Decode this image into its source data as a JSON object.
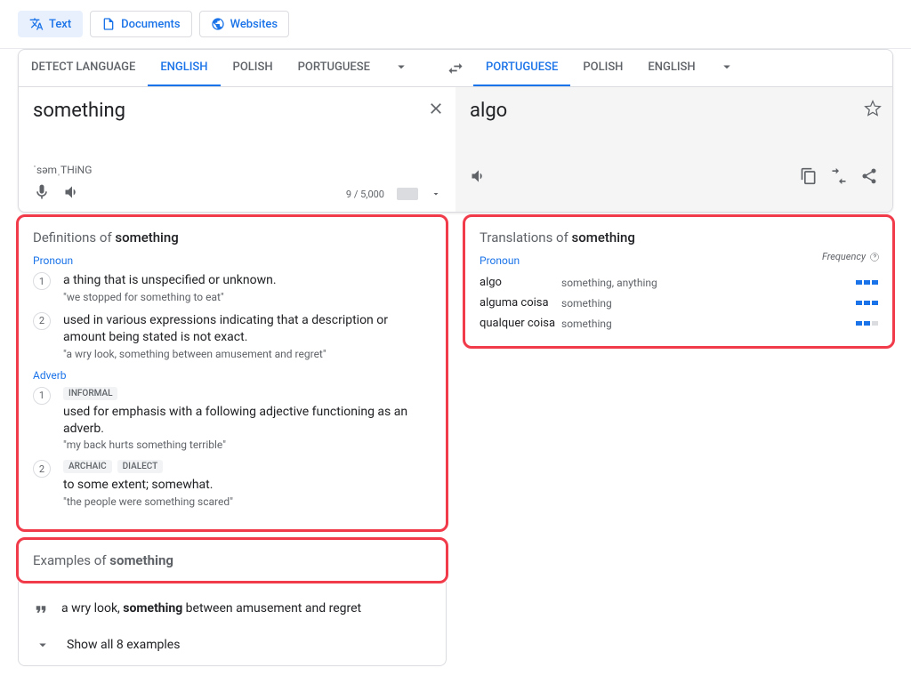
{
  "topTabs": {
    "text": "Text",
    "documents": "Documents",
    "websites": "Websites"
  },
  "langs": {
    "srcDetect": "DETECT LANGUAGE",
    "srcEn": "ENGLISH",
    "srcPl": "POLISH",
    "srcPt": "PORTUGUESE",
    "tgtPt": "PORTUGUESE",
    "tgtPl": "POLISH",
    "tgtEn": "ENGLISH"
  },
  "input": {
    "text": "something",
    "phonetic": "ˈsəmˌTHiNG",
    "charcount": "9 / 5,000"
  },
  "output": {
    "text": "algo"
  },
  "definitions": {
    "titlePrefix": "Definitions of ",
    "word": "something",
    "groups": [
      {
        "pos": "Pronoun",
        "items": [
          {
            "n": "1",
            "def": "a thing that is unspecified or unknown.",
            "ex": "\"we stopped for something to eat\"",
            "tags": []
          },
          {
            "n": "2",
            "def": "used in various expressions indicating that a description or amount being stated is not exact.",
            "ex": "\"a wry look, something between amusement and regret\"",
            "tags": []
          }
        ]
      },
      {
        "pos": "Adverb",
        "items": [
          {
            "n": "1",
            "def": "used for emphasis with a following adjective functioning as an adverb.",
            "ex": "\"my back hurts something terrible\"",
            "tags": [
              "INFORMAL"
            ]
          },
          {
            "n": "2",
            "def": "to some extent; somewhat.",
            "ex": "\"the people were something scared\"",
            "tags": [
              "ARCHAIC",
              "DIALECT"
            ]
          }
        ]
      }
    ]
  },
  "examples": {
    "titlePrefix": "Examples of ",
    "word": "something",
    "items": [
      {
        "pre": "a wry look, ",
        "bold": "something",
        "post": " between amusement and regret"
      }
    ],
    "showAll": "Show all 8 examples"
  },
  "translations": {
    "titlePrefix": "Translations of ",
    "word": "something",
    "freqLabel": "Frequency",
    "pos": "Pronoun",
    "items": [
      {
        "word": "algo",
        "rev": "something, anything",
        "freq": 3
      },
      {
        "word": "alguma coisa",
        "rev": "something",
        "freq": 3
      },
      {
        "word": "qualquer coisa",
        "rev": "something",
        "freq": 2
      }
    ]
  }
}
